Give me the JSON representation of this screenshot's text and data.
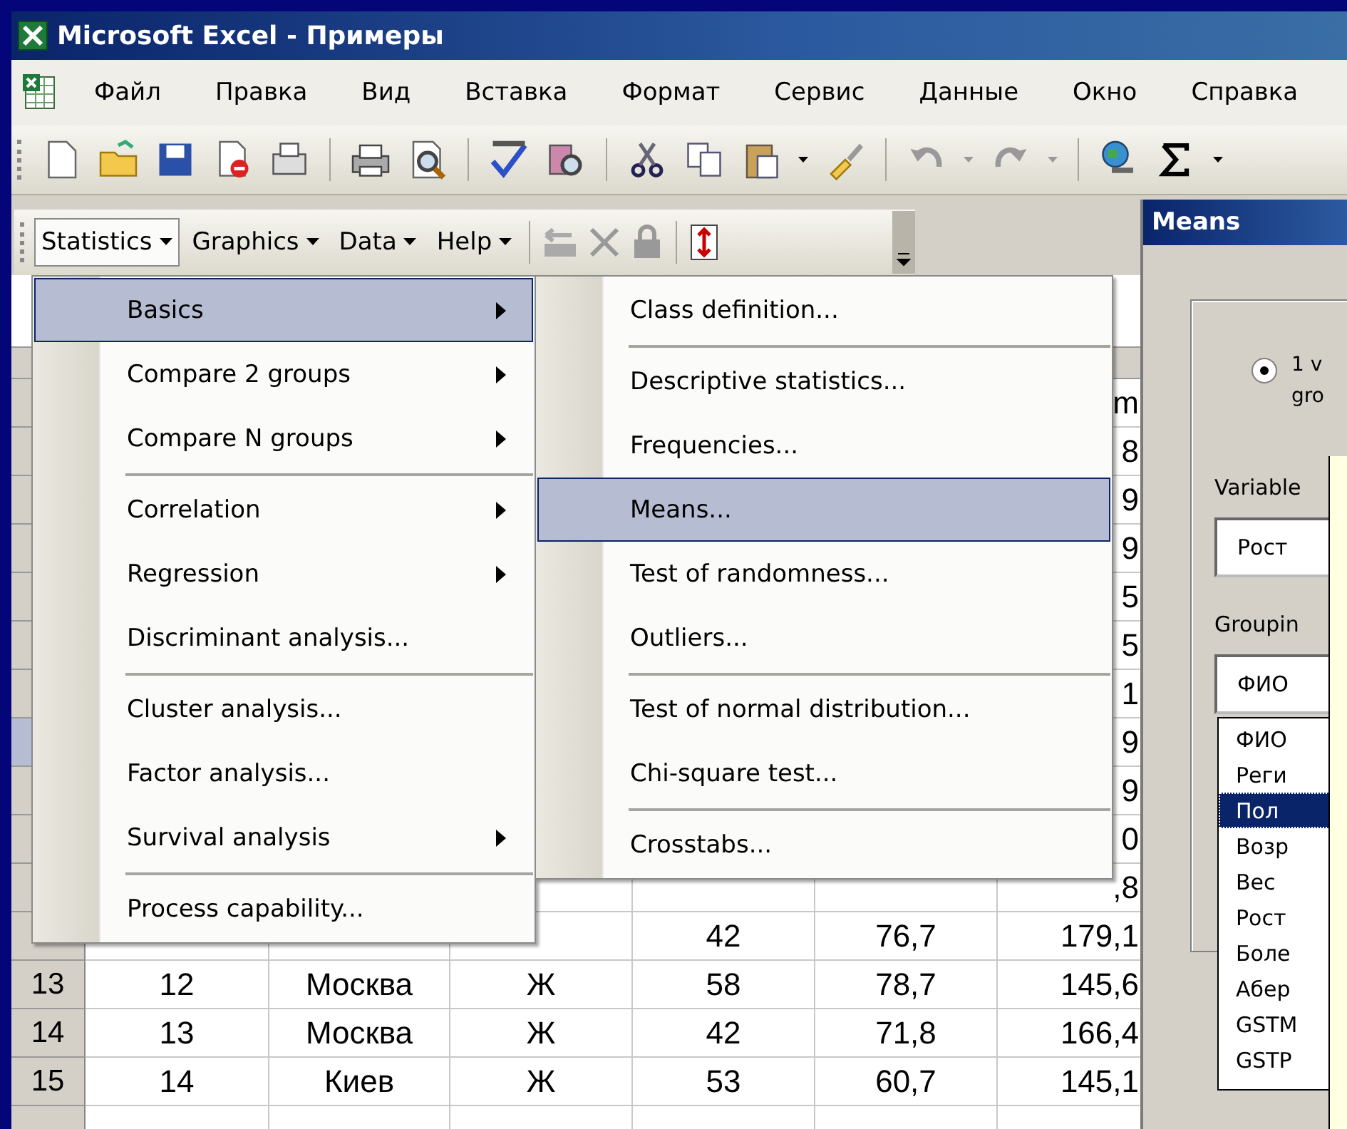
{
  "window": {
    "title": "Microsoft Excel - Примеры"
  },
  "menu_bar": {
    "items": [
      "Файл",
      "Правка",
      "Вид",
      "Вставка",
      "Формат",
      "Сервис",
      "Данные",
      "Окно",
      "Справка"
    ]
  },
  "stats_toolbar": {
    "menus": [
      {
        "label": "Statistics",
        "selected": true
      },
      {
        "label": "Graphics",
        "selected": false
      },
      {
        "label": "Data",
        "selected": false
      },
      {
        "label": "Help",
        "selected": false
      }
    ]
  },
  "statistics_menu": {
    "items": [
      {
        "kind": "submenu",
        "label": "Basics",
        "selected": true
      },
      {
        "kind": "submenu",
        "label": "Compare 2 groups",
        "selected": false
      },
      {
        "kind": "submenu",
        "label": "Compare N groups",
        "selected": false
      },
      {
        "kind": "separator"
      },
      {
        "kind": "submenu",
        "label": "Correlation",
        "selected": false
      },
      {
        "kind": "submenu",
        "label": "Regression",
        "selected": false
      },
      {
        "kind": "command",
        "label": "Discriminant analysis...",
        "selected": false
      },
      {
        "kind": "separator"
      },
      {
        "kind": "command",
        "label": "Cluster analysis...",
        "selected": false
      },
      {
        "kind": "command",
        "label": "Factor analysis...",
        "selected": false
      },
      {
        "kind": "submenu",
        "label": "Survival analysis",
        "selected": false
      },
      {
        "kind": "separator"
      },
      {
        "kind": "command",
        "label": "Process capability...",
        "selected": false
      }
    ]
  },
  "basics_submenu": {
    "items": [
      {
        "kind": "command",
        "label": "Class definition...",
        "selected": false
      },
      {
        "kind": "separator"
      },
      {
        "kind": "command",
        "label": "Descriptive statistics...",
        "selected": false
      },
      {
        "kind": "command",
        "label": "Frequencies...",
        "selected": false
      },
      {
        "kind": "command",
        "label": "Means...",
        "selected": true
      },
      {
        "kind": "command",
        "label": "Test of randomness...",
        "selected": false
      },
      {
        "kind": "command",
        "label": "Outliers...",
        "selected": false
      },
      {
        "kind": "separator"
      },
      {
        "kind": "command",
        "label": "Test of normal distribution...",
        "selected": false
      },
      {
        "kind": "command",
        "label": "Chi-square test...",
        "selected": false
      },
      {
        "kind": "separator"
      },
      {
        "kind": "command",
        "label": "Crosstabs...",
        "selected": false
      }
    ]
  },
  "sheet": {
    "rows": [
      {
        "selected": false,
        "column_6": "m"
      },
      {
        "selected": false,
        "column_6": "8"
      },
      {
        "selected": false,
        "column_6": "9"
      },
      {
        "selected": false,
        "column_6": "9"
      },
      {
        "selected": false,
        "column_6": "5"
      },
      {
        "selected": false,
        "column_6": "5"
      },
      {
        "selected": false,
        "column_6": "1"
      },
      {
        "selected": true,
        "column_6": "9"
      },
      {
        "selected": false,
        "column_6": "9"
      },
      {
        "selected": false,
        "column_6": "0"
      },
      {
        "selected": false,
        "column_6": ",8"
      },
      {
        "selected": false,
        "column_4": "42",
        "column_5": "76,7",
        "column_6": "179,1"
      },
      {
        "selected": false,
        "row_header": "13",
        "column_1": "12",
        "column_2": "Москва",
        "column_3": "Ж",
        "column_4": "58",
        "column_5": "78,7",
        "column_6": "145,6"
      },
      {
        "selected": false,
        "row_header": "14",
        "column_1": "13",
        "column_2": "Москва",
        "column_3": "Ж",
        "column_4": "42",
        "column_5": "71,8",
        "column_6": "166,4"
      },
      {
        "selected": false,
        "row_header": "15",
        "column_1": "14",
        "column_2": "Киев",
        "column_3": "Ж",
        "column_4": "53",
        "column_5": "60,7",
        "column_6": "145,1"
      }
    ]
  },
  "means_dialog": {
    "title": "Means",
    "radio": {
      "label": "1 v gro",
      "checked": true
    },
    "variable_label": "Variable",
    "variable_field": {
      "value": "Рост"
    },
    "grouping_label": "Groupin",
    "grouping_field": {
      "value": "ФИО"
    },
    "grouping_list": [
      {
        "label": "ФИО",
        "selected": false
      },
      {
        "label": "Реги",
        "selected": false
      },
      {
        "label": "Пол",
        "selected": true
      },
      {
        "label": "Возр",
        "selected": false
      },
      {
        "label": "Вес",
        "selected": false
      },
      {
        "label": "Рост",
        "selected": false
      },
      {
        "label": "Боле",
        "selected": false
      },
      {
        "label": "Абер",
        "selected": false
      },
      {
        "label": "GSTM",
        "selected": false
      },
      {
        "label": "GSTP",
        "selected": false
      }
    ]
  }
}
